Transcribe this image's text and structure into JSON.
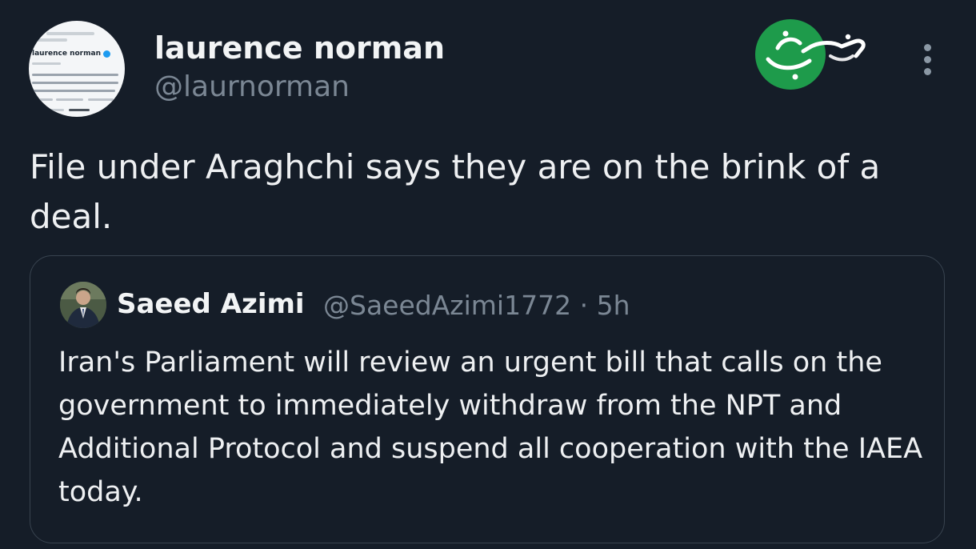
{
  "tweet": {
    "author": {
      "name": "laurence norman",
      "handle": "@laurnorman",
      "avatar_preview_name": "laurence norman"
    },
    "text": "File under Araghchi says they are on the brink of a deal.",
    "more_icon": "more-vertical-icon"
  },
  "quoted_tweet": {
    "author": {
      "name": "Saeed Azimi",
      "handle": "@SaeedAzimi1772",
      "time": "5h"
    },
    "meta_separator": " · ",
    "text": "Iran's Parliament will review an urgent bill that calls on the government to immediately withdraw from the NPT and Additional Protocol and suspend all cooperation with the IAEA today."
  },
  "watermark": {
    "logo_text": "خبرفوری",
    "logo_color": "#1e9b4b"
  },
  "colors": {
    "background": "#151d28",
    "primary_text": "#eef0f2",
    "secondary_text": "#7b8794",
    "border": "#38434f",
    "verified": "#1d9bf0"
  }
}
